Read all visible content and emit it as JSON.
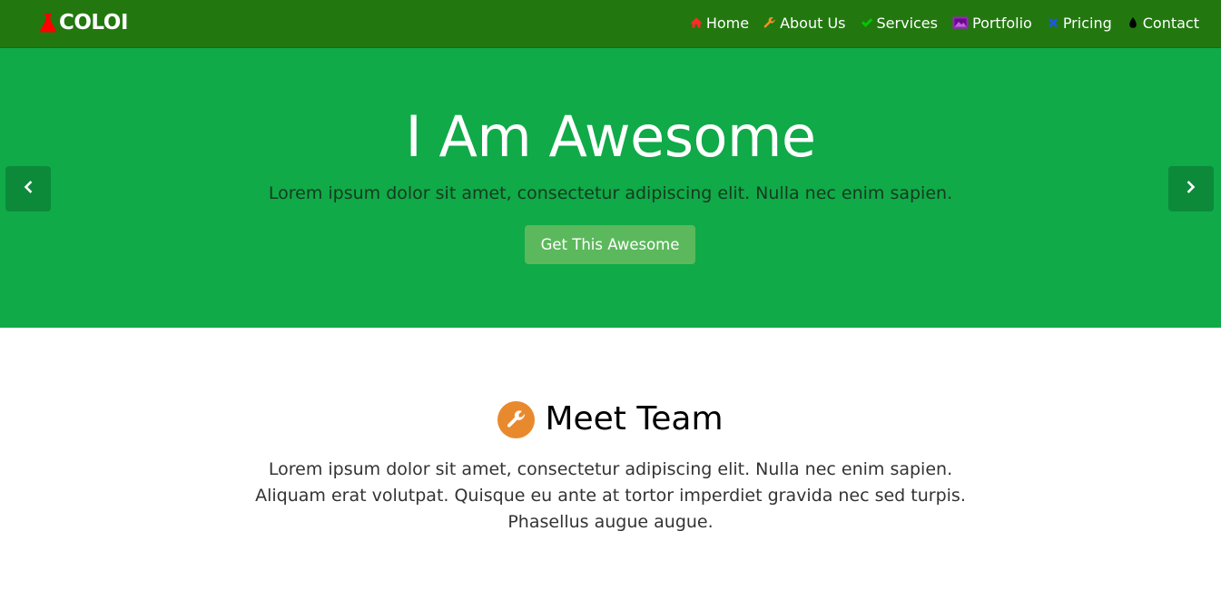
{
  "brand": {
    "name": "COLOI",
    "icon": "flask-icon",
    "icon_color": "#ff0000"
  },
  "nav": {
    "items": [
      {
        "label": "Home",
        "icon": "home-icon",
        "color": "#ff2a2a"
      },
      {
        "label": "About Us",
        "icon": "wrench-icon",
        "color": "#f0932b"
      },
      {
        "label": "Services",
        "icon": "check-icon",
        "color": "#00c800"
      },
      {
        "label": "Portfolio",
        "icon": "picture-icon",
        "color": "#a020c8"
      },
      {
        "label": "Pricing",
        "icon": "times-icon",
        "color": "#1e56e8"
      },
      {
        "label": "Contact",
        "icon": "drop-icon",
        "color": "#000000"
      }
    ]
  },
  "hero": {
    "title": "I Am Awesome",
    "subtitle": "Lorem ipsum dolor sit amet, consectetur adipiscing elit. Nulla nec enim sapien.",
    "button_label": "Get This Awesome",
    "background": "#10aa48",
    "prev_icon": "chevron-left-icon",
    "next_icon": "chevron-right-icon"
  },
  "section": {
    "icon": "wrench-icon",
    "icon_bg": "#e9892e",
    "title": "Meet Team",
    "text_lines": [
      "Lorem ipsum dolor sit amet, consectetur adipiscing elit. Nulla nec enim sapien.",
      "Aliquam erat volutpat. Quisque eu ante at tortor imperdiet gravida nec sed turpis.",
      "Phasellus augue augue."
    ]
  }
}
